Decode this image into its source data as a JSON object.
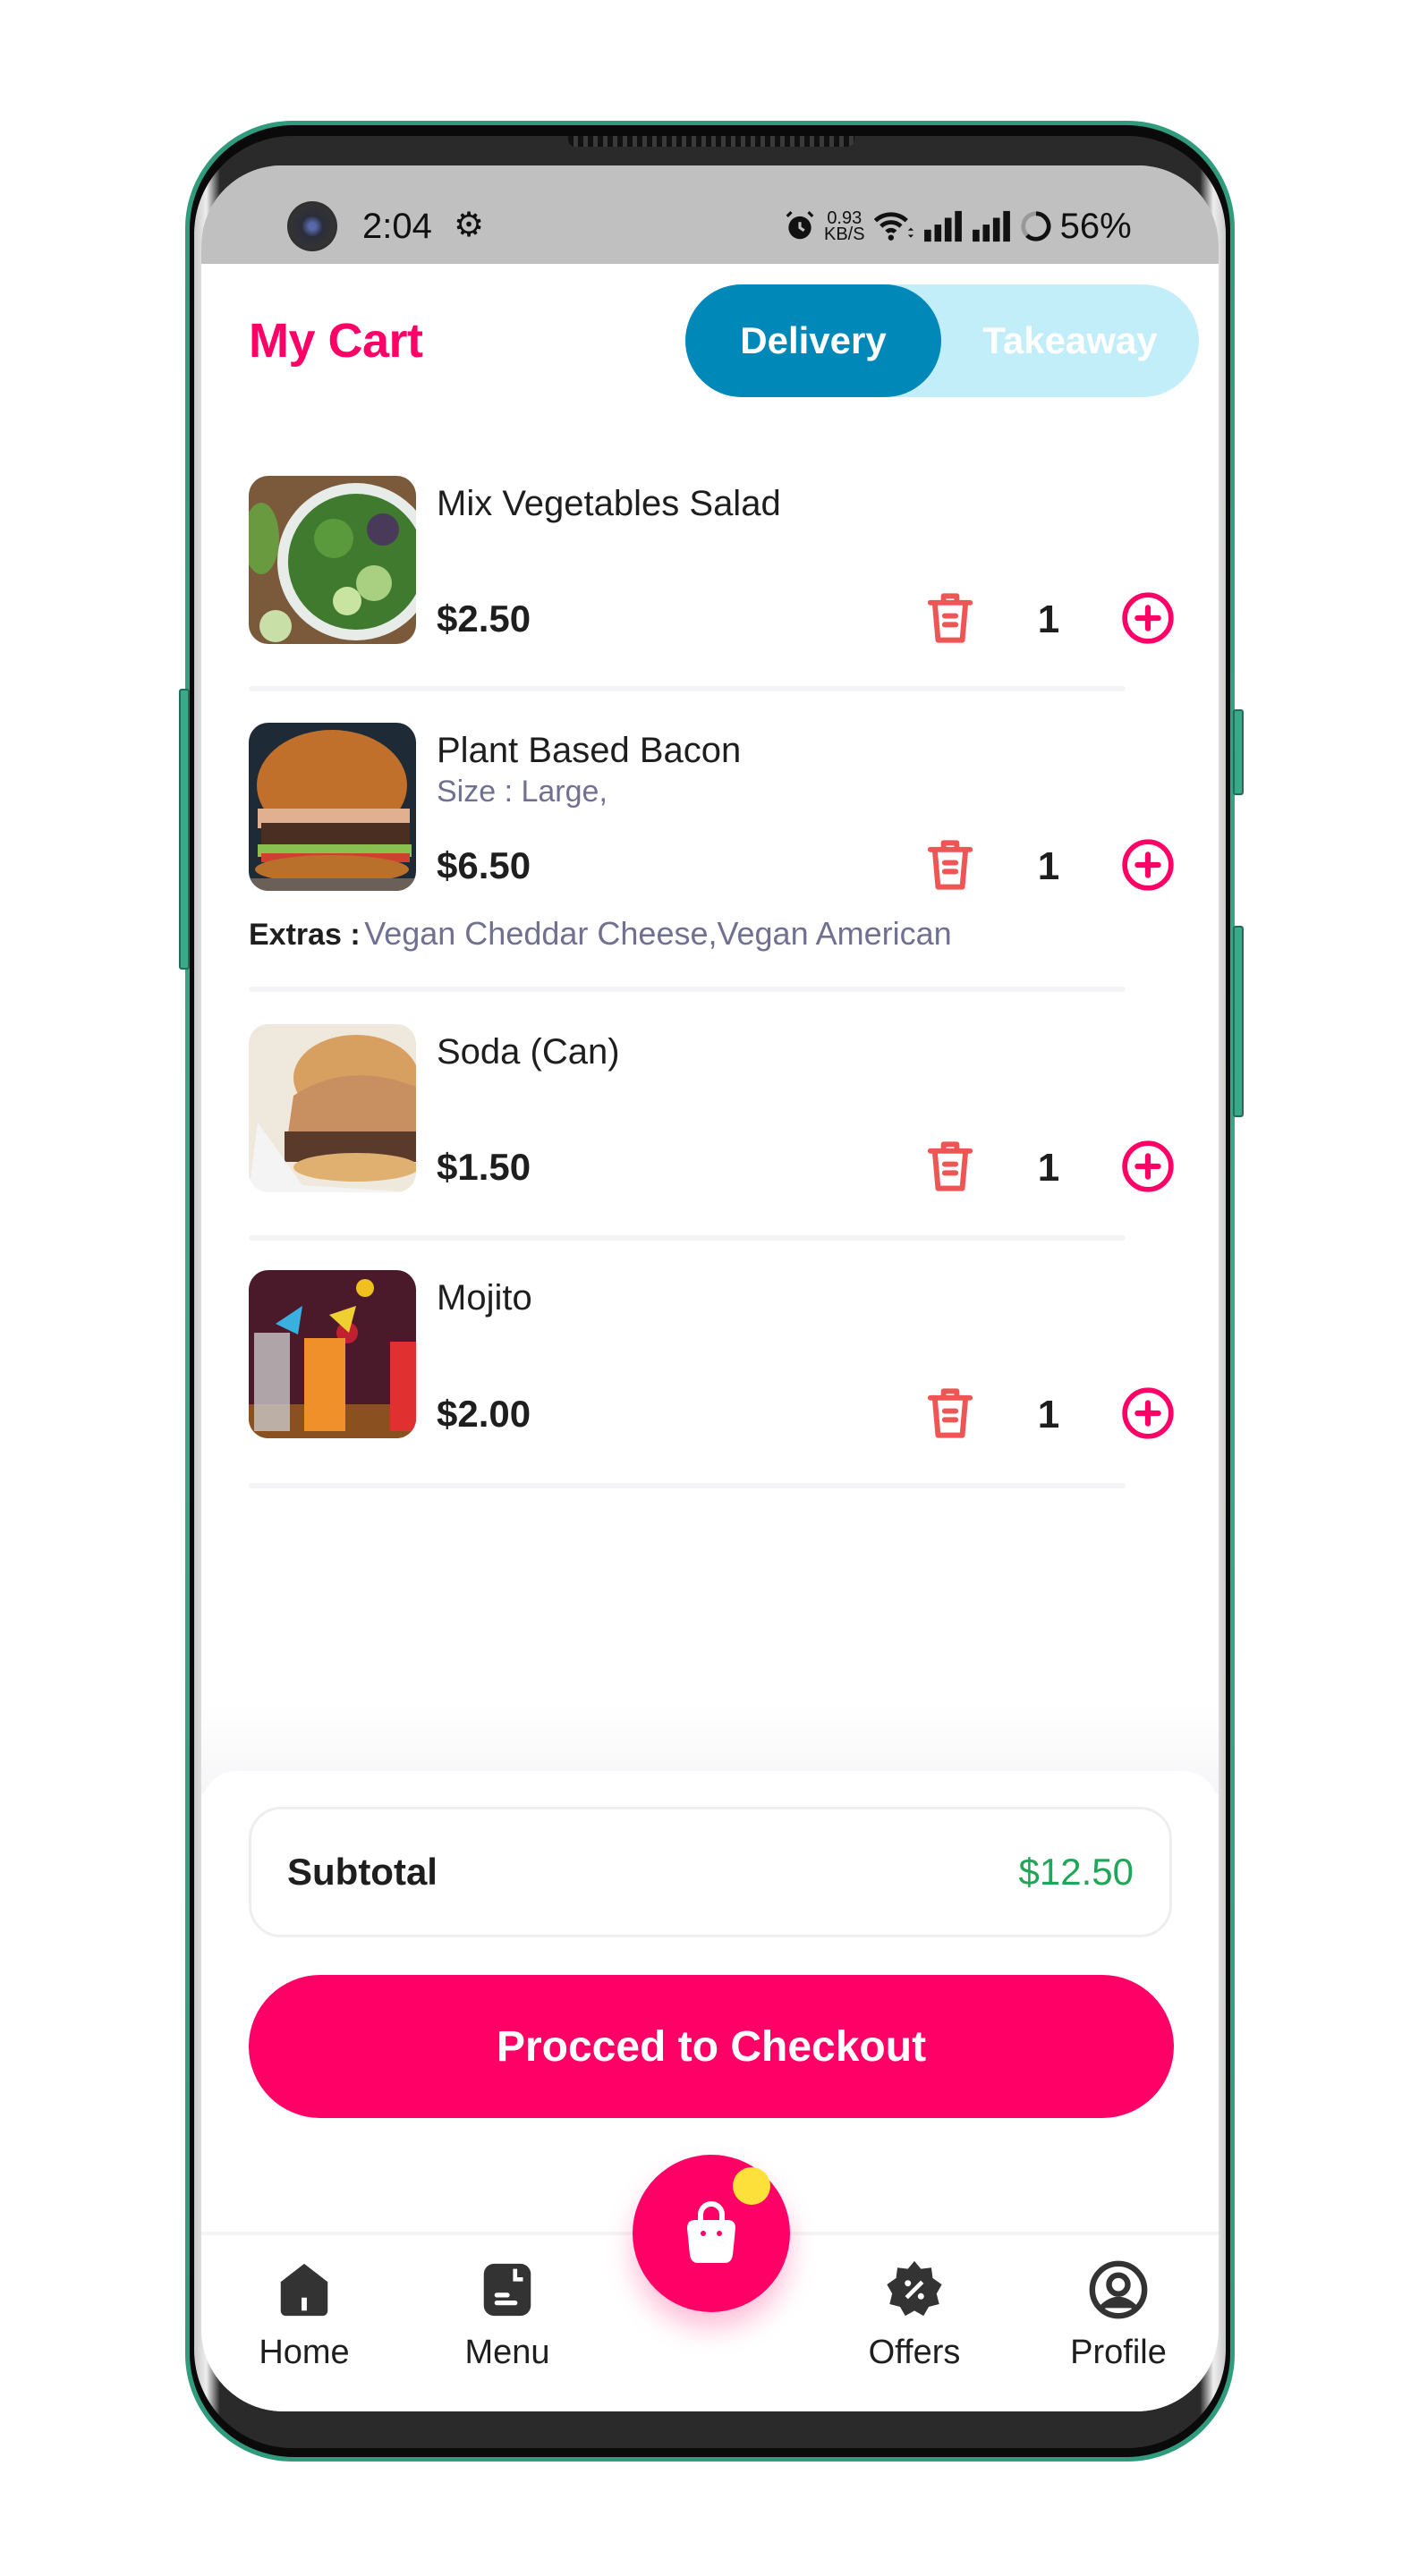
{
  "status_bar": {
    "time": "2:04",
    "net_speed_value": "0.93",
    "net_speed_unit": "KB/S",
    "battery": "56%",
    "icons": [
      "camera-cutout",
      "gear-icon",
      "alarm-icon",
      "wifi-icon",
      "signal-icon",
      "signal-icon",
      "battery-ring-icon"
    ]
  },
  "header": {
    "title": "My Cart",
    "toggle": {
      "options": [
        {
          "label": "Delivery",
          "selected": true
        },
        {
          "label": "Takeaway",
          "selected": false
        }
      ]
    }
  },
  "cart": {
    "items": [
      {
        "name": "Mix Vegetables Salad",
        "size": "",
        "price": "$2.50",
        "quantity": "1",
        "extras_label": "",
        "extras": "",
        "image": "salad-photo"
      },
      {
        "name": "Plant Based Bacon",
        "size": "Size : Large,",
        "price": "$6.50",
        "quantity": "1",
        "extras_label": "Extras :",
        "extras": "Vegan Cheddar Cheese,Vegan American",
        "image": "burger-photo"
      },
      {
        "name": "Soda (Can)",
        "size": "",
        "price": "$1.50",
        "quantity": "1",
        "extras_label": "",
        "extras": "",
        "image": "sandwich-photo"
      },
      {
        "name": "Mojito",
        "size": "",
        "price": "$2.00",
        "quantity": "1",
        "extras_label": "",
        "extras": "",
        "image": "cocktails-photo"
      }
    ]
  },
  "summary": {
    "subtotal_label": "Subtotal",
    "subtotal_value": "$12.50",
    "checkout_label": "Procced to Checkout"
  },
  "nav": {
    "items": [
      {
        "label": "Home",
        "icon": "home-icon"
      },
      {
        "label": "Menu",
        "icon": "menu-document-icon"
      },
      {
        "label": "Offers",
        "icon": "discount-badge-icon"
      },
      {
        "label": "Profile",
        "icon": "profile-icon"
      }
    ],
    "fab_icon": "shopping-bag-icon"
  },
  "colors": {
    "brand_pink": "#FF0066",
    "toggle_active": "#0088B8",
    "toggle_inactive": "#C2EEFA",
    "trash": "#EE5555",
    "subtotal_green": "#21A558",
    "badge_yellow": "#FDE13A",
    "phone_frame": "#3AA889"
  }
}
